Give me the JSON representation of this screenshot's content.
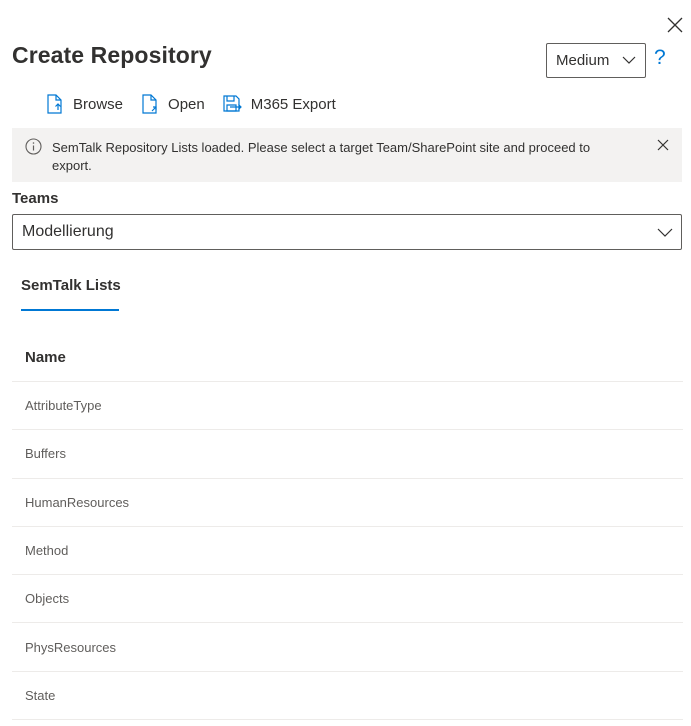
{
  "dialog": {
    "title": "Create Repository",
    "size_select": {
      "value": "Medium"
    },
    "help_label": "?"
  },
  "toolbar": {
    "items": [
      {
        "label": "Browse",
        "icon": "document-arrow-icon"
      },
      {
        "label": "Open",
        "icon": "open-file-icon"
      },
      {
        "label": "M365 Export",
        "icon": "save-export-icon"
      }
    ]
  },
  "message_bar": {
    "text": "SemTalk Repository Lists loaded. Please select a target Team/SharePoint site and proceed to export."
  },
  "teams": {
    "label": "Teams",
    "value": "Modellierung"
  },
  "tabs": [
    {
      "label": "SemTalk Lists",
      "selected": true
    }
  ],
  "list": {
    "column_header": "Name",
    "rows": [
      "AttributeType",
      "Buffers",
      "HumanResources",
      "Method",
      "Objects",
      "PhysResources",
      "State"
    ]
  },
  "colors": {
    "accent": "#0078d4",
    "message_bg": "#f3f2f1",
    "text": "#323130",
    "secondary_text": "#605e5c"
  }
}
